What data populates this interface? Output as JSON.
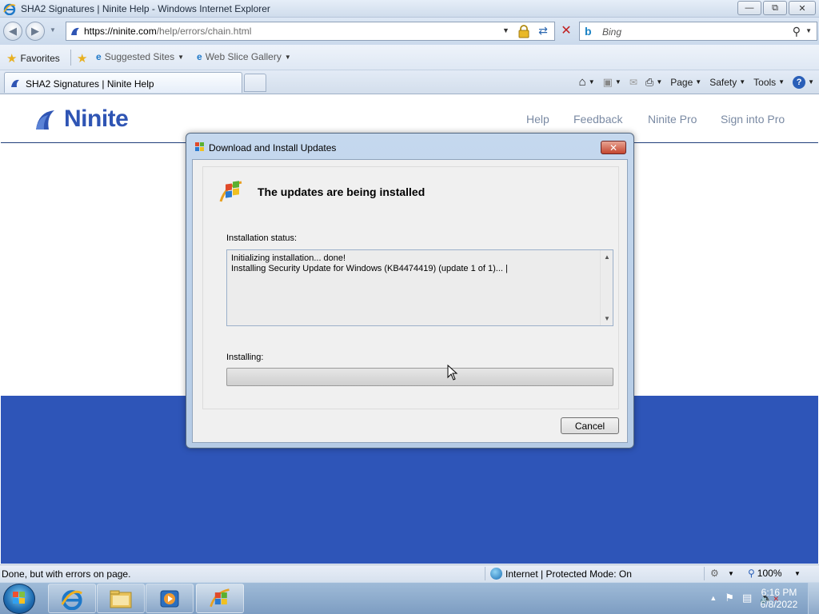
{
  "window": {
    "title": "SHA2 Signatures | Ninite Help - Windows Internet Explorer",
    "minimize_icon": "minimize-icon",
    "maximize_icon": "restore-icon",
    "close_icon": "close-icon"
  },
  "address": {
    "url_scheme_host": "https://ninite.com",
    "url_path": "/help/errors/chain.html",
    "search_placeholder": "Bing"
  },
  "favorites": {
    "favorites_label": "Favorites",
    "suggested_label": "Suggested Sites",
    "webslice_label": "Web Slice Gallery"
  },
  "tabs": {
    "active_label": "SHA2 Signatures | Ninite Help"
  },
  "commandbar": {
    "page_label": "Page",
    "safety_label": "Safety",
    "tools_label": "Tools"
  },
  "site": {
    "logo_text": "Ninite",
    "nav": [
      "Help",
      "Feedback",
      "Ninite Pro",
      "Sign into Pro"
    ],
    "brand_color": "#2e55b8"
  },
  "dialog": {
    "title": "Download and Install Updates",
    "heading": "The updates are being installed",
    "status_label": "Installation status:",
    "status_lines": [
      "Initializing installation... done!",
      "Installing Security Update for Windows (KB4474419) (update 1 of 1)... |"
    ],
    "installing_label": "Installing:",
    "progress_fraction": 0.0,
    "cancel_label": "Cancel"
  },
  "statusbar": {
    "message": "Done, but with errors on page.",
    "zone": "Internet | Protected Mode: On",
    "zoom": "100%"
  },
  "taskbar": {
    "time": "6:16 PM",
    "date": "6/8/2022"
  }
}
